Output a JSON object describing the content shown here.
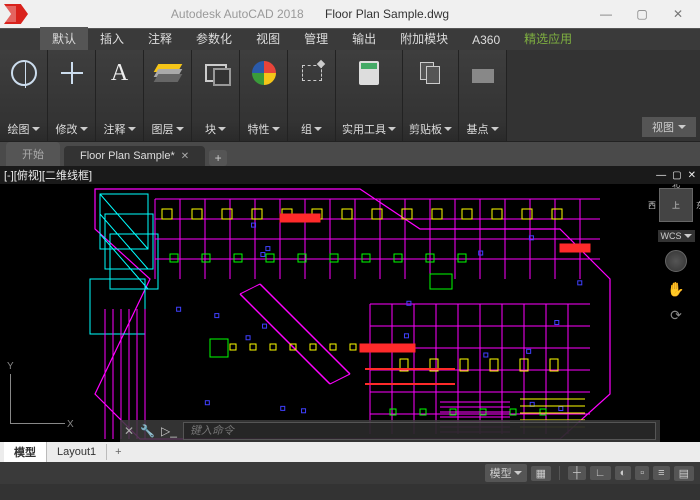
{
  "title": {
    "app": "Autodesk AutoCAD 2018",
    "file": "Floor Plan Sample.dwg"
  },
  "winbtns": {
    "min": "—",
    "max": "▢",
    "close": "✕"
  },
  "menu": [
    {
      "label": "默认",
      "active": true
    },
    {
      "label": "插入"
    },
    {
      "label": "注释"
    },
    {
      "label": "参数化"
    },
    {
      "label": "视图"
    },
    {
      "label": "管理"
    },
    {
      "label": "输出"
    },
    {
      "label": "附加模块"
    },
    {
      "label": "A360"
    },
    {
      "label": "精选应用",
      "green": true
    }
  ],
  "ribbon": [
    {
      "label": "绘图",
      "icon": "draw"
    },
    {
      "label": "修改",
      "icon": "modify"
    },
    {
      "label": "注释",
      "icon": "annotate"
    },
    {
      "label": "图层",
      "icon": "layers"
    },
    {
      "label": "块",
      "icon": "block"
    },
    {
      "label": "特性",
      "icon": "properties"
    },
    {
      "label": "组",
      "icon": "group"
    },
    {
      "label": "实用工具",
      "icon": "utilities"
    },
    {
      "label": "剪贴板",
      "icon": "clipboard"
    },
    {
      "label": "基点",
      "icon": "base"
    }
  ],
  "ribbon_view_tab": "视图",
  "filetabs": {
    "start": "开始",
    "active": "Floor Plan Sample*",
    "add": "+"
  },
  "viewport": {
    "label": "[-][俯视][二维线框]",
    "wcs": "WCS",
    "cube_face": "上",
    "cube_dirs": {
      "n": "北",
      "e": "东",
      "w": "西"
    },
    "ucs": {
      "x": "X",
      "y": "Y"
    },
    "ctrl": {
      "min": "—",
      "max": "▢",
      "close": "✕"
    }
  },
  "cmd": {
    "x": "✕",
    "wrench": "🔧",
    "prompt": "▷_",
    "placeholder": "键入命令"
  },
  "layouts": {
    "model": "模型",
    "l1": "Layout1",
    "add": "+"
  },
  "status": {
    "model": "模型",
    "grid": "▦",
    "snap": "◉"
  },
  "colors": {
    "magenta": "#ff00ff",
    "cyan": "#00ffff",
    "yellow": "#ffff00",
    "green": "#00ff00",
    "red": "#ff2a2a",
    "blue": "#4040ff"
  }
}
